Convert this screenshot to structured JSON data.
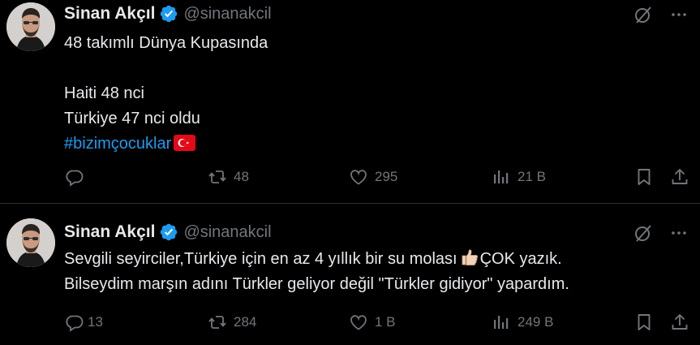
{
  "colors": {
    "background": "#000000",
    "text": "#e7e9ea",
    "muted": "#71767b",
    "link": "#1d9bf0",
    "verified": "#1d9bf0",
    "divider": "#2f3336"
  },
  "tweets": [
    {
      "author": {
        "name": "Sinan Akçıl",
        "handle": "@sinanakcil",
        "verified_icon": "verified-badge-icon"
      },
      "lines": [
        "48 takımlı Dünya Kupasında",
        "",
        "Haiti 48 nci",
        "Türkiye 47 nci oldu"
      ],
      "hashtag": "#bizimçocuklar",
      "emoji": "turkey-flag",
      "stats": {
        "replies": "",
        "retweets": "48",
        "likes": "295",
        "views": "21 B"
      }
    },
    {
      "author": {
        "name": "Sinan Akçıl",
        "handle": "@sinanakcil",
        "verified_icon": "verified-badge-icon"
      },
      "lines": [
        "Sevgili seyirciler,Türkiye için en az 4 yıllık bir su molası",
        "Bilseydim marşın adını Türkler geliyor değil \"Türkler gidiyor\" yapardım."
      ],
      "line1_suffix": "ÇOK yazık.",
      "emoji": "thumbs-up",
      "stats": {
        "replies": "13",
        "retweets": "284",
        "likes": "1 B",
        "views": "249 B"
      }
    }
  ]
}
